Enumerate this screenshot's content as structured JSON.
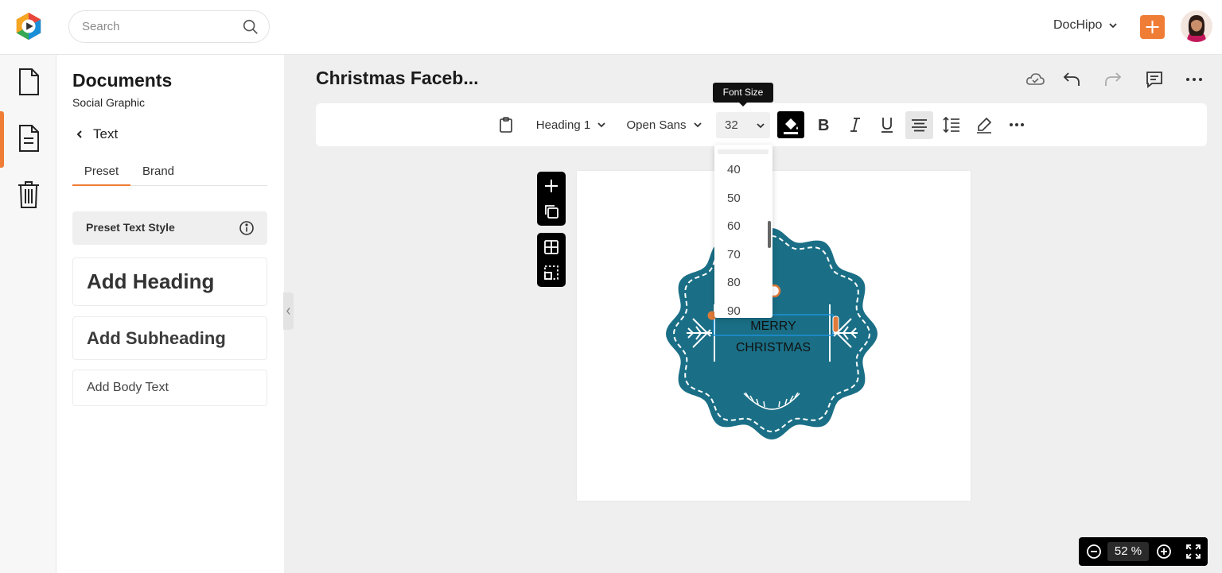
{
  "header": {
    "search_placeholder": "Search",
    "account_label": "DocHipo",
    "accent_color": "#f07d35"
  },
  "sidebar_rail": {
    "items": [
      "document-icon",
      "text-document-icon",
      "trash-icon"
    ],
    "active_index": 1
  },
  "panel": {
    "title": "Documents",
    "subtitle": "Social Graphic",
    "back_label": "Text",
    "tabs": [
      "Preset",
      "Brand"
    ],
    "active_tab": "Preset",
    "preset_header": "Preset Text Style",
    "add_heading": "Add Heading",
    "add_subheading": "Add Subheading",
    "add_body": "Add Body Text"
  },
  "document": {
    "title": "Christmas Faceb..."
  },
  "toolbar": {
    "style_label": "Heading 1",
    "font_label": "Open Sans",
    "font_size": "32",
    "tooltip": "Font Size"
  },
  "font_size_dropdown": {
    "options": [
      "40",
      "50",
      "60",
      "70",
      "80",
      "90"
    ]
  },
  "canvas": {
    "text_line1": "MERRY",
    "text_line2": "CHRISTMAS",
    "badge_color": "#1a6f86"
  },
  "zoom": {
    "value": "52",
    "unit": "%"
  }
}
